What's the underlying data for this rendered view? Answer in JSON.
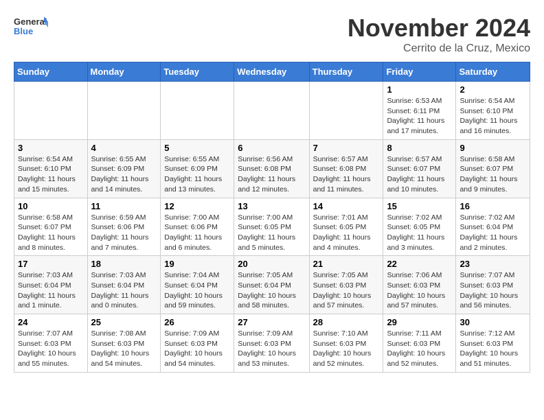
{
  "header": {
    "logo_line1": "General",
    "logo_line2": "Blue",
    "month_title": "November 2024",
    "location": "Cerrito de la Cruz, Mexico"
  },
  "weekdays": [
    "Sunday",
    "Monday",
    "Tuesday",
    "Wednesday",
    "Thursday",
    "Friday",
    "Saturday"
  ],
  "weeks": [
    [
      {
        "day": "",
        "info": ""
      },
      {
        "day": "",
        "info": ""
      },
      {
        "day": "",
        "info": ""
      },
      {
        "day": "",
        "info": ""
      },
      {
        "day": "",
        "info": ""
      },
      {
        "day": "1",
        "info": "Sunrise: 6:53 AM\nSunset: 6:11 PM\nDaylight: 11 hours and 17 minutes."
      },
      {
        "day": "2",
        "info": "Sunrise: 6:54 AM\nSunset: 6:10 PM\nDaylight: 11 hours and 16 minutes."
      }
    ],
    [
      {
        "day": "3",
        "info": "Sunrise: 6:54 AM\nSunset: 6:10 PM\nDaylight: 11 hours and 15 minutes."
      },
      {
        "day": "4",
        "info": "Sunrise: 6:55 AM\nSunset: 6:09 PM\nDaylight: 11 hours and 14 minutes."
      },
      {
        "day": "5",
        "info": "Sunrise: 6:55 AM\nSunset: 6:09 PM\nDaylight: 11 hours and 13 minutes."
      },
      {
        "day": "6",
        "info": "Sunrise: 6:56 AM\nSunset: 6:08 PM\nDaylight: 11 hours and 12 minutes."
      },
      {
        "day": "7",
        "info": "Sunrise: 6:57 AM\nSunset: 6:08 PM\nDaylight: 11 hours and 11 minutes."
      },
      {
        "day": "8",
        "info": "Sunrise: 6:57 AM\nSunset: 6:07 PM\nDaylight: 11 hours and 10 minutes."
      },
      {
        "day": "9",
        "info": "Sunrise: 6:58 AM\nSunset: 6:07 PM\nDaylight: 11 hours and 9 minutes."
      }
    ],
    [
      {
        "day": "10",
        "info": "Sunrise: 6:58 AM\nSunset: 6:07 PM\nDaylight: 11 hours and 8 minutes."
      },
      {
        "day": "11",
        "info": "Sunrise: 6:59 AM\nSunset: 6:06 PM\nDaylight: 11 hours and 7 minutes."
      },
      {
        "day": "12",
        "info": "Sunrise: 7:00 AM\nSunset: 6:06 PM\nDaylight: 11 hours and 6 minutes."
      },
      {
        "day": "13",
        "info": "Sunrise: 7:00 AM\nSunset: 6:05 PM\nDaylight: 11 hours and 5 minutes."
      },
      {
        "day": "14",
        "info": "Sunrise: 7:01 AM\nSunset: 6:05 PM\nDaylight: 11 hours and 4 minutes."
      },
      {
        "day": "15",
        "info": "Sunrise: 7:02 AM\nSunset: 6:05 PM\nDaylight: 11 hours and 3 minutes."
      },
      {
        "day": "16",
        "info": "Sunrise: 7:02 AM\nSunset: 6:04 PM\nDaylight: 11 hours and 2 minutes."
      }
    ],
    [
      {
        "day": "17",
        "info": "Sunrise: 7:03 AM\nSunset: 6:04 PM\nDaylight: 11 hours and 1 minute."
      },
      {
        "day": "18",
        "info": "Sunrise: 7:03 AM\nSunset: 6:04 PM\nDaylight: 11 hours and 0 minutes."
      },
      {
        "day": "19",
        "info": "Sunrise: 7:04 AM\nSunset: 6:04 PM\nDaylight: 10 hours and 59 minutes."
      },
      {
        "day": "20",
        "info": "Sunrise: 7:05 AM\nSunset: 6:04 PM\nDaylight: 10 hours and 58 minutes."
      },
      {
        "day": "21",
        "info": "Sunrise: 7:05 AM\nSunset: 6:03 PM\nDaylight: 10 hours and 57 minutes."
      },
      {
        "day": "22",
        "info": "Sunrise: 7:06 AM\nSunset: 6:03 PM\nDaylight: 10 hours and 57 minutes."
      },
      {
        "day": "23",
        "info": "Sunrise: 7:07 AM\nSunset: 6:03 PM\nDaylight: 10 hours and 56 minutes."
      }
    ],
    [
      {
        "day": "24",
        "info": "Sunrise: 7:07 AM\nSunset: 6:03 PM\nDaylight: 10 hours and 55 minutes."
      },
      {
        "day": "25",
        "info": "Sunrise: 7:08 AM\nSunset: 6:03 PM\nDaylight: 10 hours and 54 minutes."
      },
      {
        "day": "26",
        "info": "Sunrise: 7:09 AM\nSunset: 6:03 PM\nDaylight: 10 hours and 54 minutes."
      },
      {
        "day": "27",
        "info": "Sunrise: 7:09 AM\nSunset: 6:03 PM\nDaylight: 10 hours and 53 minutes."
      },
      {
        "day": "28",
        "info": "Sunrise: 7:10 AM\nSunset: 6:03 PM\nDaylight: 10 hours and 52 minutes."
      },
      {
        "day": "29",
        "info": "Sunrise: 7:11 AM\nSunset: 6:03 PM\nDaylight: 10 hours and 52 minutes."
      },
      {
        "day": "30",
        "info": "Sunrise: 7:12 AM\nSunset: 6:03 PM\nDaylight: 10 hours and 51 minutes."
      }
    ]
  ]
}
